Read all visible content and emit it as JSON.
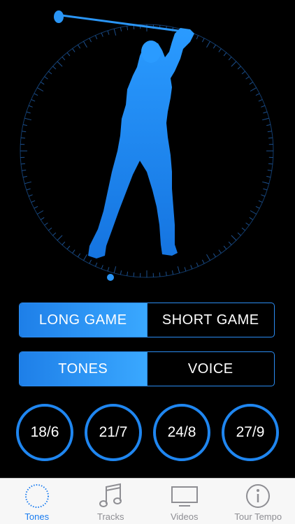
{
  "game_selector": {
    "options": [
      "LONG GAME",
      "SHORT GAME"
    ],
    "selected": "LONG GAME"
  },
  "mode_selector": {
    "options": [
      "TONES",
      "VOICE"
    ],
    "selected": "TONES"
  },
  "tempo_ratios": [
    "18/6",
    "21/7",
    "24/8",
    "27/9"
  ],
  "tabbar": {
    "tabs": [
      {
        "label": "Tones",
        "icon": "dial-icon",
        "active": true
      },
      {
        "label": "Tracks",
        "icon": "music-note-icon",
        "active": false
      },
      {
        "label": "Videos",
        "icon": "tv-icon",
        "active": false
      },
      {
        "label": "Tour Tempo",
        "icon": "info-icon",
        "active": false
      }
    ]
  },
  "colors": {
    "accent": "#1e7fe8",
    "accent_light": "#3aa8ff",
    "background": "#000000",
    "tabbar_bg": "#f7f7f7",
    "inactive_tab": "#8e8e93"
  }
}
